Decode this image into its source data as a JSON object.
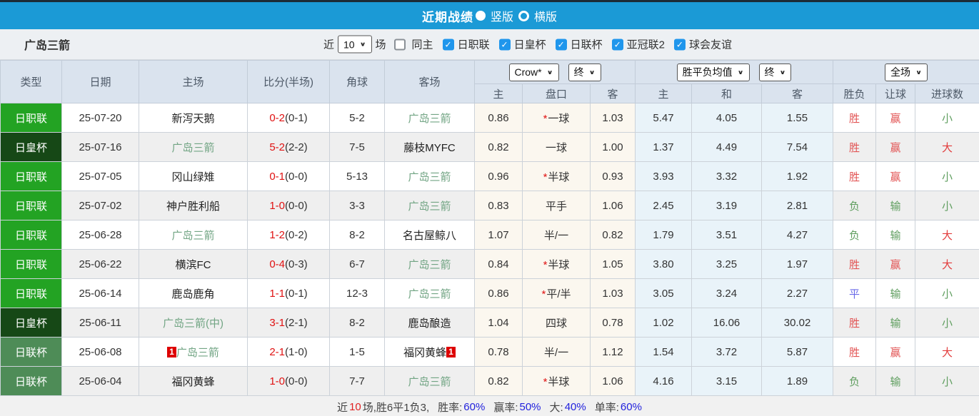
{
  "title_bar": {
    "title": "近期战绩",
    "radio_vertical_label": "竖版",
    "radio_horizontal_label": "横版"
  },
  "filter_bar": {
    "team_name": "广岛三箭",
    "recent_label": "近",
    "count_value": "10",
    "games_label": "场",
    "same_home_label": "同主",
    "leagues": [
      "日职联",
      "日皇杯",
      "日联杯",
      "亚冠联2",
      "球会友谊"
    ]
  },
  "table": {
    "headers": {
      "type": "类型",
      "date": "日期",
      "home": "主场",
      "score": "比分(半场)",
      "corner": "角球",
      "away": "客场",
      "odds_home": "主",
      "odds_handicap": "盘口",
      "odds_away": "客",
      "avg_home": "主",
      "avg_draw": "和",
      "avg_away": "客",
      "result_wdl": "胜负",
      "result_handicap": "让球",
      "result_goals": "进球数",
      "dropdown_company": "Crow*",
      "dropdown_final1": "终",
      "dropdown_avg": "胜平负均值",
      "dropdown_final2": "终",
      "dropdown_fulltime": "全场"
    },
    "rows": [
      {
        "league": "日职联",
        "date": "25-07-20",
        "home": {
          "name": "新泻天鹅",
          "highlight": false
        },
        "score": {
          "full": "0-2",
          "half": "(0-1)"
        },
        "corner": "5-2",
        "away": {
          "name": "广岛三箭",
          "highlight": true
        },
        "odds": {
          "home": "0.86",
          "handicap": "*一球",
          "away": "1.03"
        },
        "avg": {
          "home": "5.47",
          "draw": "4.05",
          "away": "1.55"
        },
        "results": {
          "wdl": "胜",
          "handicap": "赢",
          "goals": "小"
        }
      },
      {
        "league": "日皇杯",
        "date": "25-07-16",
        "home": {
          "name": "广岛三箭",
          "highlight": true
        },
        "score": {
          "full": "5-2",
          "half": "(2-2)"
        },
        "corner": "7-5",
        "away": {
          "name": "藤枝MYFC",
          "highlight": false
        },
        "odds": {
          "home": "0.82",
          "handicap": "一球",
          "away": "1.00"
        },
        "avg": {
          "home": "1.37",
          "draw": "4.49",
          "away": "7.54"
        },
        "results": {
          "wdl": "胜",
          "handicap": "赢",
          "goals": "大"
        }
      },
      {
        "league": "日职联",
        "date": "25-07-05",
        "home": {
          "name": "冈山绿雉",
          "highlight": false
        },
        "score": {
          "full": "0-1",
          "half": "(0-0)"
        },
        "corner": "5-13",
        "away": {
          "name": "广岛三箭",
          "highlight": true
        },
        "odds": {
          "home": "0.96",
          "handicap": "*半球",
          "away": "0.93"
        },
        "avg": {
          "home": "3.93",
          "draw": "3.32",
          "away": "1.92"
        },
        "results": {
          "wdl": "胜",
          "handicap": "赢",
          "goals": "小"
        }
      },
      {
        "league": "日职联",
        "date": "25-07-02",
        "home": {
          "name": "神户胜利船",
          "highlight": false
        },
        "score": {
          "full": "1-0",
          "half": "(0-0)"
        },
        "corner": "3-3",
        "away": {
          "name": "广岛三箭",
          "highlight": true
        },
        "odds": {
          "home": "0.83",
          "handicap": "平手",
          "away": "1.06"
        },
        "avg": {
          "home": "2.45",
          "draw": "3.19",
          "away": "2.81"
        },
        "results": {
          "wdl": "负",
          "handicap": "输",
          "goals": "小"
        }
      },
      {
        "league": "日职联",
        "date": "25-06-28",
        "home": {
          "name": "广岛三箭",
          "highlight": true
        },
        "score": {
          "full": "1-2",
          "half": "(0-2)"
        },
        "corner": "8-2",
        "away": {
          "name": "名古屋鲸八",
          "highlight": false
        },
        "odds": {
          "home": "1.07",
          "handicap": "半/一",
          "away": "0.82"
        },
        "avg": {
          "home": "1.79",
          "draw": "3.51",
          "away": "4.27"
        },
        "results": {
          "wdl": "负",
          "handicap": "输",
          "goals": "大"
        }
      },
      {
        "league": "日职联",
        "date": "25-06-22",
        "home": {
          "name": "横滨FC",
          "highlight": false
        },
        "score": {
          "full": "0-4",
          "half": "(0-3)"
        },
        "corner": "6-7",
        "away": {
          "name": "广岛三箭",
          "highlight": true
        },
        "odds": {
          "home": "0.84",
          "handicap": "*半球",
          "away": "1.05"
        },
        "avg": {
          "home": "3.80",
          "draw": "3.25",
          "away": "1.97"
        },
        "results": {
          "wdl": "胜",
          "handicap": "赢",
          "goals": "大"
        }
      },
      {
        "league": "日职联",
        "date": "25-06-14",
        "home": {
          "name": "鹿岛鹿角",
          "highlight": false
        },
        "score": {
          "full": "1-1",
          "half": "(0-1)"
        },
        "corner": "12-3",
        "away": {
          "name": "广岛三箭",
          "highlight": true
        },
        "odds": {
          "home": "0.86",
          "handicap": "*平/半",
          "away": "1.03"
        },
        "avg": {
          "home": "3.05",
          "draw": "3.24",
          "away": "2.27"
        },
        "results": {
          "wdl": "平",
          "handicap": "输",
          "goals": "小"
        }
      },
      {
        "league": "日皇杯",
        "date": "25-06-11",
        "home": {
          "name": "广岛三箭(中)",
          "highlight": true
        },
        "score": {
          "full": "3-1",
          "half": "(2-1)"
        },
        "corner": "8-2",
        "away": {
          "name": "鹿岛酿造",
          "highlight": false
        },
        "odds": {
          "home": "1.04",
          "handicap": "四球",
          "away": "0.78"
        },
        "avg": {
          "home": "1.02",
          "draw": "16.06",
          "away": "30.02"
        },
        "results": {
          "wdl": "胜",
          "handicap": "输",
          "goals": "小"
        }
      },
      {
        "league": "日联杯",
        "date": "25-06-08",
        "home": {
          "name": "广岛三箭",
          "highlight": true,
          "card_before": "1"
        },
        "score": {
          "full": "2-1",
          "half": "(1-0)"
        },
        "corner": "1-5",
        "away": {
          "name": "福冈黄蜂",
          "highlight": false,
          "card_after": "1"
        },
        "odds": {
          "home": "0.78",
          "handicap": "半/一",
          "away": "1.12"
        },
        "avg": {
          "home": "1.54",
          "draw": "3.72",
          "away": "5.87"
        },
        "results": {
          "wdl": "胜",
          "handicap": "赢",
          "goals": "大"
        }
      },
      {
        "league": "日联杯",
        "date": "25-06-04",
        "home": {
          "name": "福冈黄蜂",
          "highlight": false
        },
        "score": {
          "full": "1-0",
          "half": "(0-0)"
        },
        "corner": "7-7",
        "away": {
          "name": "广岛三箭",
          "highlight": true
        },
        "odds": {
          "home": "0.82",
          "handicap": "*半球",
          "away": "1.06"
        },
        "avg": {
          "home": "4.16",
          "draw": "3.15",
          "away": "1.89"
        },
        "results": {
          "wdl": "负",
          "handicap": "输",
          "goals": "小"
        }
      }
    ]
  },
  "footer": {
    "prefix": "近",
    "count": "10",
    "summary": "场,胜6平1负3,",
    "win_rate_label": "胜率:",
    "win_rate": "60%",
    "cover_rate_label": "赢率:",
    "cover_rate": "50%",
    "big_rate_label": "大:",
    "big_rate": "40%",
    "single_rate_label": "单率:",
    "single_rate": "60%"
  },
  "colors": {
    "title_bar_bg": "#1b9ad6",
    "checkbox_blue": "#1f96ec",
    "leagues": {
      "日职联": "#23a323",
      "日皇杯": "#164816",
      "日联杯": "#4e8c57"
    },
    "result_map": {
      "胜": "#e25555",
      "平": "#6a6ae8",
      "负": "#5f9e5f",
      "赢": "#e25555",
      "输": "#5f9e5f",
      "大": "#e23c3c",
      "小": "#5f9e5f"
    },
    "score_red": "#e01212",
    "team_highlight_green": "#72a584"
  }
}
